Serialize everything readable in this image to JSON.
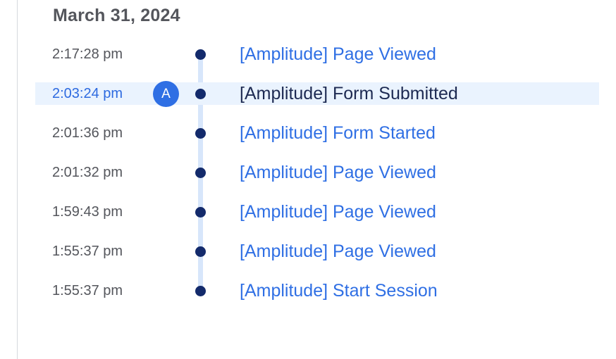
{
  "header": {
    "date": "March 31, 2024"
  },
  "colors": {
    "link": "#2f6fe4",
    "selected_row_bg": "#eaf3fe",
    "timeline_line": "#d7e6fb",
    "timeline_dot": "#132a6b",
    "badge": "#2f6fe4",
    "muted_text": "#54565c"
  },
  "events": [
    {
      "time": "2:17:28 pm",
      "name": "[Amplitude] Page Viewed",
      "selected": false
    },
    {
      "time": "2:03:24 pm",
      "name": "[Amplitude] Form Submitted",
      "selected": true,
      "badge": "A"
    },
    {
      "time": "2:01:36 pm",
      "name": "[Amplitude] Form Started",
      "selected": false
    },
    {
      "time": "2:01:32 pm",
      "name": "[Amplitude] Page Viewed",
      "selected": false
    },
    {
      "time": "1:59:43 pm",
      "name": "[Amplitude] Page Viewed",
      "selected": false
    },
    {
      "time": "1:55:37 pm",
      "name": "[Amplitude] Page Viewed",
      "selected": false
    },
    {
      "time": "1:55:37 pm",
      "name": "[Amplitude] Start Session",
      "selected": false
    }
  ]
}
